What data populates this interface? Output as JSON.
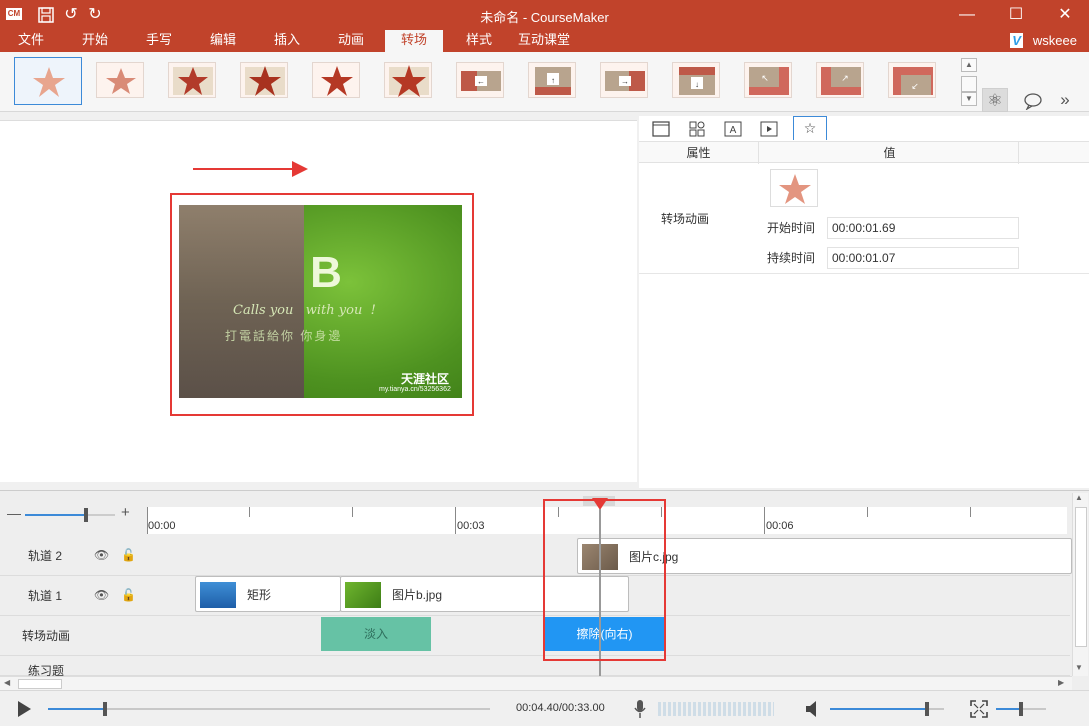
{
  "window": {
    "title": "未命名 - CourseMaker",
    "logo": "CM"
  },
  "menu": {
    "tabs": [
      "文件",
      "开始",
      "手写",
      "编辑",
      "插入",
      "动画",
      "转场",
      "样式",
      "互动课堂"
    ],
    "active_tab": "转场",
    "user": "wskeee",
    "user_logo": "V"
  },
  "properties": {
    "col_property": "属性",
    "col_value": "值",
    "row_label": "转场动画",
    "start_label": "开始时间",
    "start_value": "00:00:01.69",
    "duration_label": "持续时间",
    "duration_value": "00:00:01.07"
  },
  "canvas": {
    "image_text_main": "Calls you   with you  !",
    "image_text_sub": "打電話給你 你身邊",
    "watermark": "天涯社区",
    "watermark_url": "my.tianya.cn/53256362",
    "big_letter": "B"
  },
  "timeline": {
    "ruler_labels": [
      "00:00",
      "00:03",
      "00:06"
    ],
    "tracks": [
      {
        "name": "轨道 2"
      },
      {
        "name": "轨道 1"
      },
      {
        "name": "转场动画"
      },
      {
        "name": "练习题"
      }
    ],
    "clips": {
      "track2_clip": "图片c.jpg",
      "track1_clip1": "矩形",
      "track1_clip2": "图片b.jpg",
      "trans1": "淡入",
      "trans2": "擦除(向右)"
    }
  },
  "playback": {
    "time": "00:04.40/00:33.00",
    "progress": 0.13,
    "volume": 0.85,
    "zoom": 0.5
  },
  "colors": {
    "brand": "#c1432b",
    "accent_blue": "#2196f3",
    "trans_green": "#66c2a5",
    "highlight_red": "#e53935"
  }
}
